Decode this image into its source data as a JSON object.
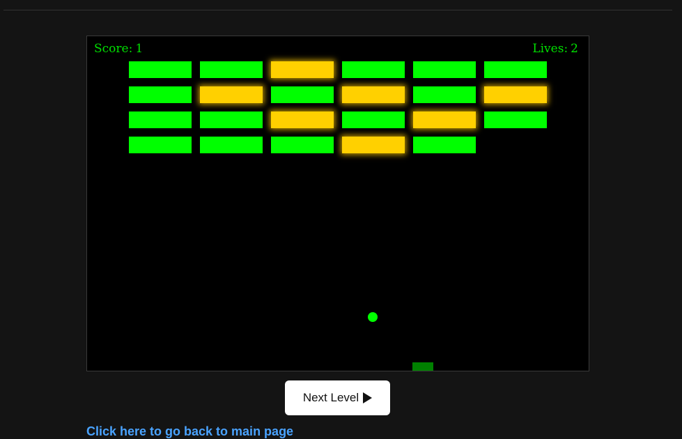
{
  "hud": {
    "score_label": "Score:",
    "score_value": "1",
    "lives_label": "Lives:",
    "lives_value": "2"
  },
  "bricks": [
    [
      "normal",
      "normal",
      "glow",
      "normal",
      "normal",
      "normal"
    ],
    [
      "normal",
      "glow",
      "normal",
      "glow",
      "normal",
      "glow"
    ],
    [
      "normal",
      "normal",
      "glow",
      "normal",
      "glow",
      "normal"
    ],
    [
      "normal",
      "normal",
      "normal",
      "glow",
      "normal",
      "none"
    ]
  ],
  "colors": {
    "brick": "#00ff00",
    "brick_glow": "#ffd000",
    "ball": "#00ff00",
    "paddle": "#008000",
    "hud_text": "#00e000",
    "link": "#4aa3ff"
  },
  "controls": {
    "next_level_label": "Next Level",
    "next_level_icon": "play-icon"
  },
  "footer": {
    "back_link_text": "Click here to go back to main page"
  }
}
